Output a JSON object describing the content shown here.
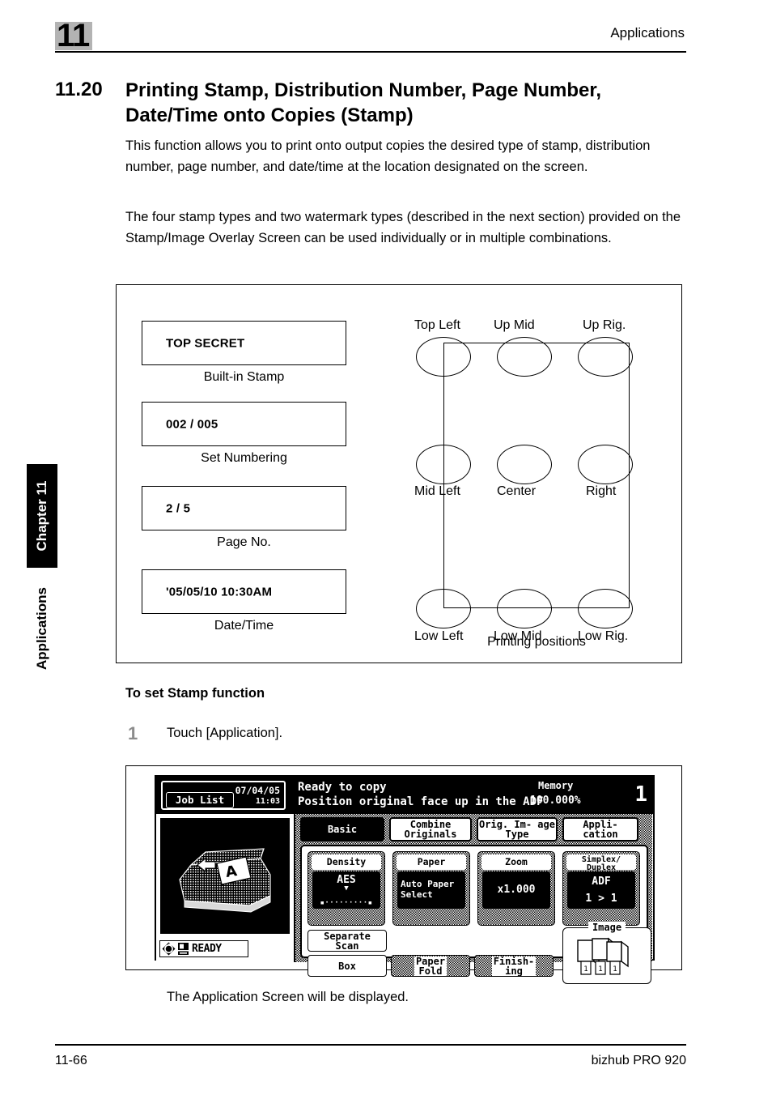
{
  "header": {
    "chapter_number": "11",
    "running_title": "Applications"
  },
  "side_tab": {
    "chapter_label": "Chapter 11",
    "section_label": "Applications"
  },
  "section": {
    "number": "11.20",
    "title": "Printing Stamp, Distribution Number, Page Number, Date/Time onto Copies (Stamp)",
    "paragraph_1": "This function allows you to print onto output copies the desired type of stamp, distribution number, page number, and date/time at the location designated on the screen.",
    "paragraph_2": "The four stamp types and two watermark types (described in the next section) provided on the Stamp/Image Overlay Screen can be used individually or in multiple combinations."
  },
  "figure": {
    "stamps": [
      {
        "sample": "TOP SECRET",
        "caption": "Built-in Stamp"
      },
      {
        "sample": "002 / 005",
        "caption": "Set Numbering"
      },
      {
        "sample": "2 / 5",
        "caption": "Page No."
      },
      {
        "sample": "'05/05/10 10:30AM",
        "caption": "Date/Time"
      }
    ],
    "positions_caption": "Printing positions",
    "positions": [
      {
        "label": "Top Left"
      },
      {
        "label": "Up Mid"
      },
      {
        "label": "Up Rig."
      },
      {
        "label": "Mid Left"
      },
      {
        "label": "Center"
      },
      {
        "label": "Right"
      },
      {
        "label": "Low Left"
      },
      {
        "label": "Low Mid"
      },
      {
        "label": "Low Rig."
      }
    ]
  },
  "procedure": {
    "subheading": "To set Stamp function",
    "step_number": "1",
    "step_text": "Touch [Application].",
    "result_text": "The Application Screen will be displayed."
  },
  "lcd": {
    "job_list_button": "Job List",
    "date": "07/04/05",
    "time": "11:03",
    "message_line1": "Ready to copy",
    "message_line2": "Position original face up in the ADF",
    "memory_label": "Memory",
    "memory_value": "100.000%",
    "copy_count": "1",
    "ready_status": "READY",
    "tabs": [
      {
        "label": "Basic",
        "selected": true
      },
      {
        "label": "Combine\nOriginals",
        "selected": false
      },
      {
        "label": "Orig. Im-\nage Type",
        "selected": false
      },
      {
        "label": "Appli-\ncation",
        "selected": false
      }
    ],
    "function_buttons": [
      {
        "title": "Density",
        "value": "AES",
        "has_slider": true,
        "slider": "▪·········▪"
      },
      {
        "title": "Paper",
        "value": "Auto Paper\nSelect",
        "has_slider": false
      },
      {
        "title": "Zoom",
        "value": "x1.000",
        "has_slider": false
      },
      {
        "title": "Simplex/\nDuplex",
        "value": "ADF\n1 > 1",
        "has_slider": false
      }
    ],
    "small_buttons": [
      {
        "label": "Separate\nScan",
        "dotted": false
      },
      {
        "label": "Box",
        "dotted": false
      },
      {
        "label": "Paper\nFold",
        "dotted": true
      },
      {
        "label": "Finish-\ning",
        "dotted": true
      }
    ],
    "image_box_label": "Image"
  },
  "footer": {
    "page_number": "11-66",
    "product": "bizhub PRO 920"
  }
}
